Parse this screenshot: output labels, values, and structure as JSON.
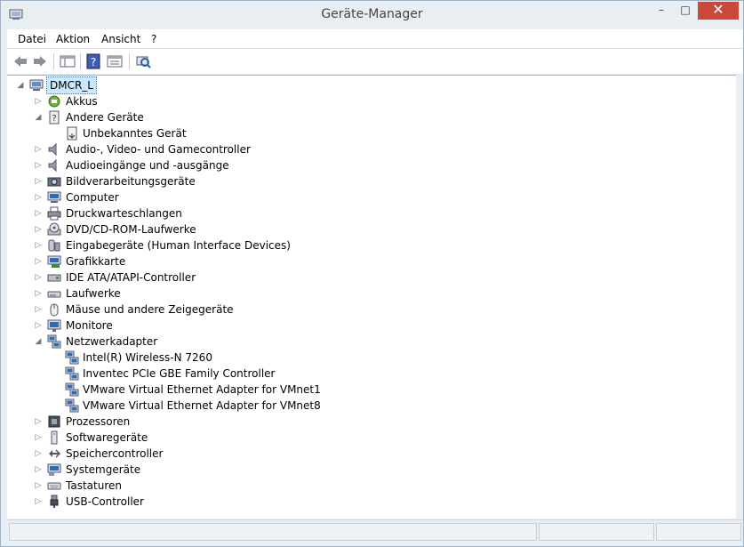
{
  "window": {
    "title": "Geräte-Manager",
    "close_glyph": "✕",
    "minimize_glyph": "–",
    "maximize_glyph": "□"
  },
  "menu": [
    "Datei",
    "Aktion",
    "Ansicht",
    "?"
  ],
  "toolbar": {
    "buttons": [
      "back-arrow-icon",
      "forward-arrow-icon",
      "console-tree-icon",
      "help-icon",
      "properties-icon",
      "scan-hardware-icon"
    ]
  },
  "tree": {
    "root": "DMCR_L",
    "nodes": [
      {
        "label": "Akkus",
        "expanded": false,
        "icon": "battery-icon"
      },
      {
        "label": "Andere Geräte",
        "expanded": true,
        "icon": "unknown-device-icon",
        "children": [
          "Unbekanntes Gerät"
        ]
      },
      {
        "label": "Audio-, Video- und Gamecontroller",
        "expanded": false,
        "icon": "speaker-icon"
      },
      {
        "label": "Audioeingänge und -ausgänge",
        "expanded": false,
        "icon": "speaker-icon"
      },
      {
        "label": "Bildverarbeitungsgeräte",
        "expanded": false,
        "icon": "camera-icon"
      },
      {
        "label": "Computer",
        "expanded": false,
        "icon": "computer-icon"
      },
      {
        "label": "Druckwarteschlangen",
        "expanded": false,
        "icon": "printer-icon"
      },
      {
        "label": "DVD/CD-ROM-Laufwerke",
        "expanded": false,
        "icon": "dvd-drive-icon"
      },
      {
        "label": "Eingabegeräte (Human Interface Devices)",
        "expanded": false,
        "icon": "hid-icon"
      },
      {
        "label": "Grafikkarte",
        "expanded": false,
        "icon": "display-adapter-icon"
      },
      {
        "label": "IDE ATA/ATAPI-Controller",
        "expanded": false,
        "icon": "ide-controller-icon"
      },
      {
        "label": "Laufwerke",
        "expanded": false,
        "icon": "disk-drive-icon"
      },
      {
        "label": "Mäuse und andere Zeigegeräte",
        "expanded": false,
        "icon": "mouse-icon"
      },
      {
        "label": "Monitore",
        "expanded": false,
        "icon": "monitor-icon"
      },
      {
        "label": "Netzwerkadapter",
        "expanded": true,
        "icon": "network-adapter-icon",
        "children": [
          "Intel(R) Wireless-N 7260",
          "Inventec PCIe GBE Family Controller",
          "VMware Virtual Ethernet Adapter for VMnet1",
          "VMware Virtual Ethernet Adapter for VMnet8"
        ]
      },
      {
        "label": "Prozessoren",
        "expanded": false,
        "icon": "processor-icon"
      },
      {
        "label": "Softwaregeräte",
        "expanded": false,
        "icon": "software-device-icon"
      },
      {
        "label": "Speichercontroller",
        "expanded": false,
        "icon": "storage-controller-icon"
      },
      {
        "label": "Systemgeräte",
        "expanded": false,
        "icon": "system-devices-icon"
      },
      {
        "label": "Tastaturen",
        "expanded": false,
        "icon": "keyboard-icon"
      },
      {
        "label": "USB-Controller",
        "expanded": false,
        "icon": "usb-icon"
      }
    ]
  },
  "colors": {
    "accent_selection": "#cce8ff",
    "close_button": "#c9483a",
    "frame": "#e9eef2"
  }
}
